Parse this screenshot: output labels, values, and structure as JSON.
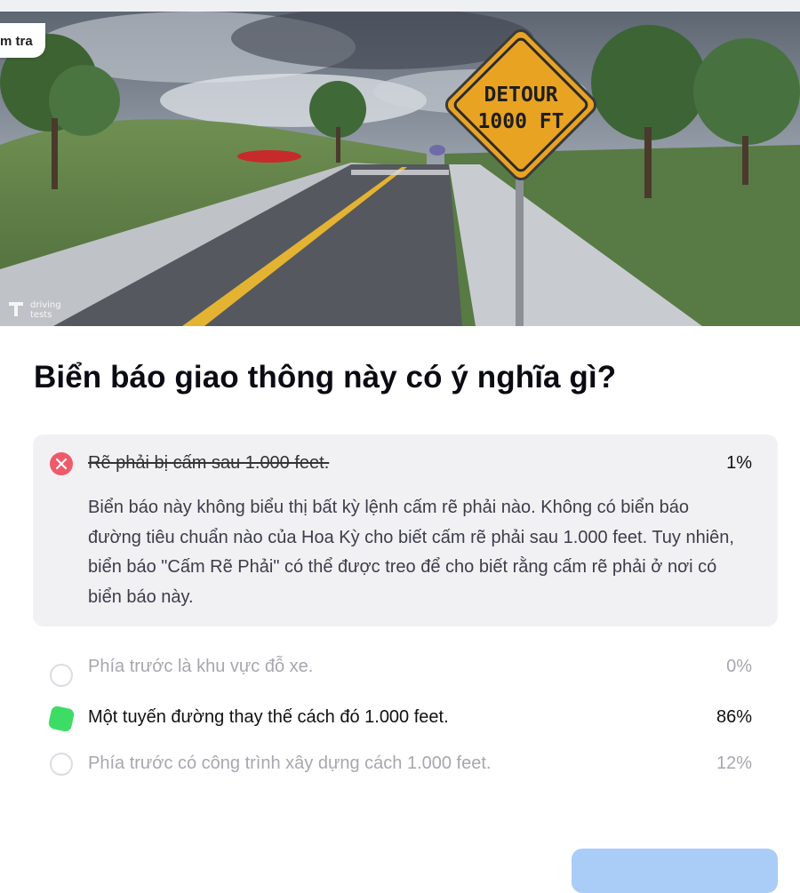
{
  "hero": {
    "tag_label": "m tra",
    "sign_line1": "DETOUR",
    "sign_line2": "1000 FT",
    "watermark_line1": "driving",
    "watermark_line2": "tests"
  },
  "question": "Biển báo giao thông này có ý nghĩa gì?",
  "answers": [
    {
      "text": "Rẽ phải bị cấm sau 1.000 feet.",
      "percent": "1%",
      "state": "wrong",
      "explanation": "Biển báo này không biểu thị bất kỳ lệnh cấm rẽ phải nào. Không có biển báo đường tiêu chuẩn nào của Hoa Kỳ cho biết cấm rẽ phải sau 1.000 feet. Tuy nhiên, biển báo \"Cấm Rẽ Phải\" có thể được treo để cho biết rằng cấm rẽ phải ở nơi có biển báo này."
    },
    {
      "text": "Phía trước là khu vực đỗ xe.",
      "percent": "0%",
      "state": "unselected"
    },
    {
      "text": "Một tuyến đường thay thế cách đó 1.000 feet.",
      "percent": "86%",
      "state": "correct"
    },
    {
      "text": "Phía trước có công trình xây dựng cách 1.000 feet.",
      "percent": "12%",
      "state": "unselected"
    }
  ],
  "colors": {
    "wrong": "#ef5a6b",
    "correct": "#3ddc64",
    "button": "#a9cdf7",
    "sign": "#e9a323"
  },
  "icons": {
    "wrong": "close-icon",
    "correct": "check-shape-icon",
    "radio": "radio-empty-icon"
  }
}
